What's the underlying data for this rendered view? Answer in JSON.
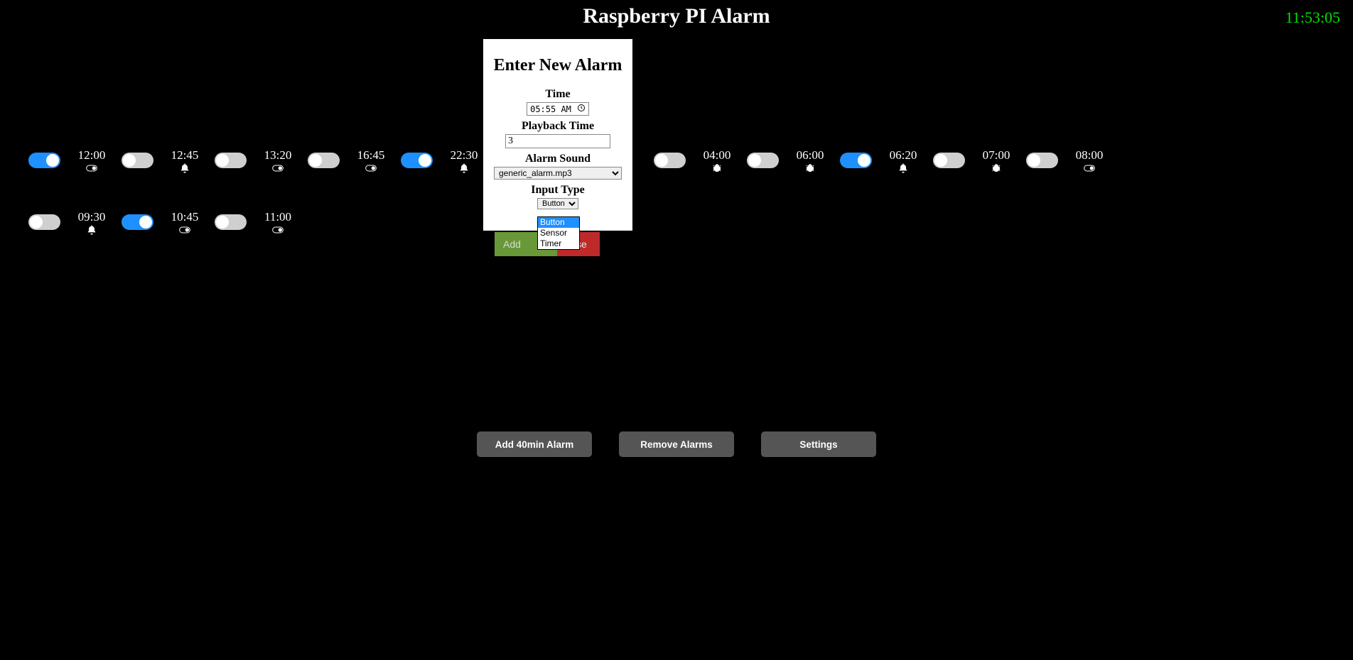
{
  "header": {
    "title": "Raspberry PI Alarm",
    "clock": "11:53:05"
  },
  "alarms_row1": [
    {
      "time": "12:00",
      "on": true,
      "icon": "toggle"
    },
    {
      "time": "12:45",
      "on": false,
      "icon": "bell"
    },
    {
      "time": "13:20",
      "on": false,
      "icon": "toggle"
    },
    {
      "time": "16:45",
      "on": false,
      "icon": "toggle"
    },
    {
      "time": "22:30",
      "on": true,
      "icon": "bell"
    },
    {
      "time": "04:00",
      "on": false,
      "icon": "bug"
    },
    {
      "time": "06:00",
      "on": false,
      "icon": "bug"
    },
    {
      "time": "06:20",
      "on": true,
      "icon": "bell"
    },
    {
      "time": "07:00",
      "on": false,
      "icon": "bug"
    },
    {
      "time": "08:00",
      "on": false,
      "icon": "toggle"
    }
  ],
  "alarms_row2": [
    {
      "time": "09:30",
      "on": false,
      "icon": "bell"
    },
    {
      "time": "10:45",
      "on": true,
      "icon": "toggle"
    },
    {
      "time": "11:00",
      "on": false,
      "icon": "toggle"
    }
  ],
  "spacer_before_row1_index": 5,
  "footer": {
    "add40": "Add 40min Alarm",
    "remove": "Remove Alarms",
    "settings": "Settings"
  },
  "modal": {
    "title": "Enter New Alarm",
    "time_label": "Time",
    "time_value": "05:55 AM",
    "playback_label": "Playback Time",
    "playback_value": "3",
    "sound_label": "Alarm Sound",
    "sound_value": "generic_alarm.mp3",
    "input_label": "Input Type",
    "input_value": "Button",
    "input_options": [
      "Button",
      "Sensor",
      "Timer"
    ],
    "add_btn": "Add",
    "close_btn": "Close"
  }
}
